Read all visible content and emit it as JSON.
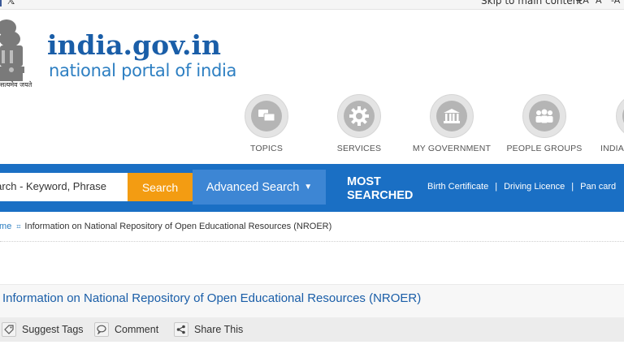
{
  "topbar": {
    "skip_link": "Skip to main content",
    "font_increase": "+A",
    "font_normal": "A",
    "font_decrease": "-A"
  },
  "logo": {
    "title": "india.gov.in",
    "subtitle": "national portal of india",
    "emblem_text": "सत्यमेव जयते"
  },
  "categories": [
    {
      "label": "TOPICS",
      "icon": "chat-bubbles-icon"
    },
    {
      "label": "SERVICES",
      "icon": "gear-icon"
    },
    {
      "label": "MY GOVERNMENT",
      "icon": "government-building-icon"
    },
    {
      "label": "PEOPLE GROUPS",
      "icon": "people-group-icon"
    },
    {
      "label": "INDIA",
      "icon": "india-icon"
    }
  ],
  "search": {
    "placeholder": "Search - Keyword, Phrase",
    "button": "Search",
    "advanced": "Advanced Search"
  },
  "most_searched": {
    "heading_line1": "MOST",
    "heading_line2": "SEARCHED",
    "links": [
      "Birth Certificate",
      "Driving Licence",
      "Pan card"
    ]
  },
  "breadcrumb": {
    "home": "Home",
    "current": "Information on National Repository of Open Educational Resources (NROER)"
  },
  "page": {
    "title": "Information on National Repository of Open Educational Resources (NROER)"
  },
  "actions": {
    "suggest": "Suggest Tags",
    "comment": "Comment",
    "share": "Share This"
  },
  "colors": {
    "brand_blue": "#1a6fc4",
    "search_orange": "#f39c12",
    "advanced_blue": "#3d86d4"
  }
}
